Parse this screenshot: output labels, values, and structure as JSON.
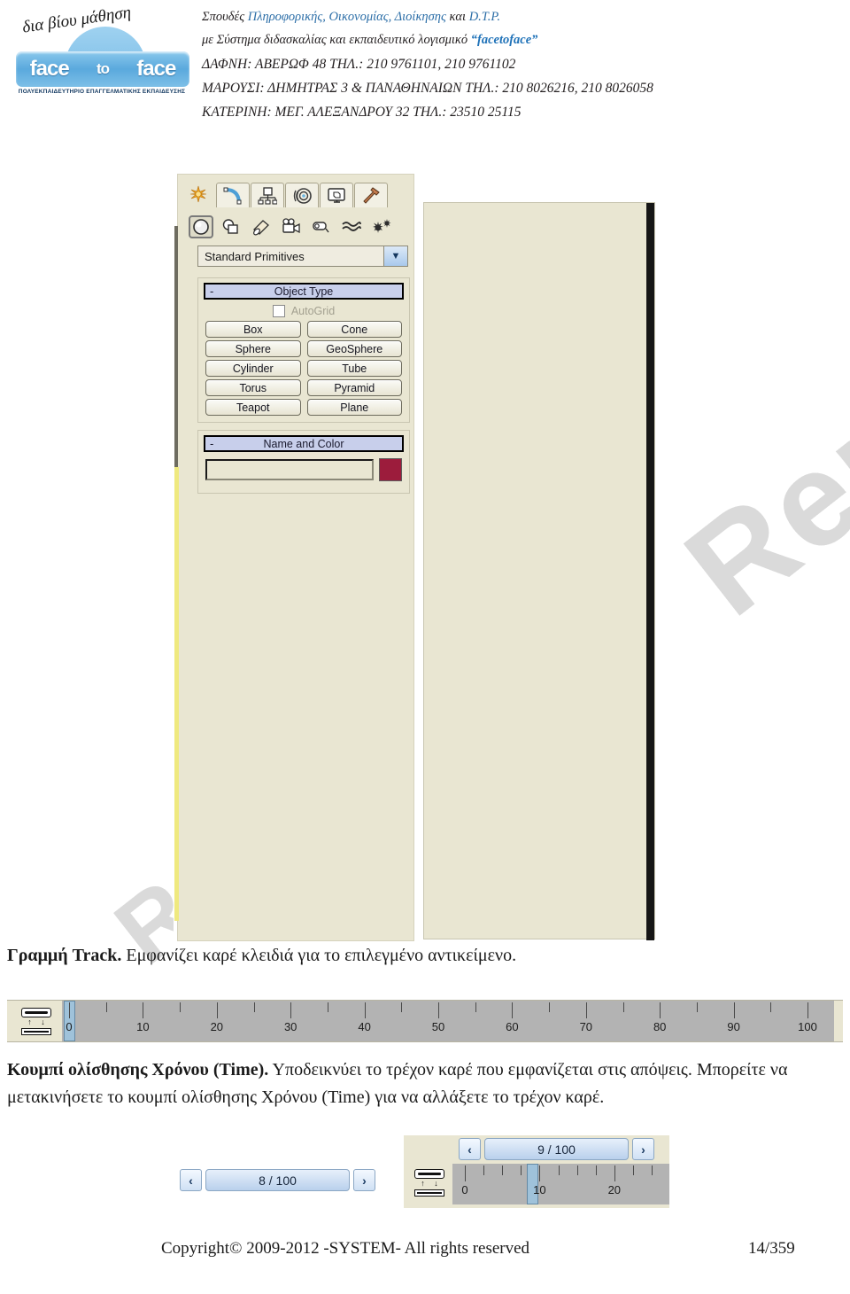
{
  "header": {
    "logo": {
      "script_text": "δια βίου μάθηση",
      "word1": "face",
      "word2": "to",
      "word3": "face",
      "subtitle": "ΠΟΛΥΕΚΠΑΙΔΕΥΤΗΡΙΟ ΕΠΑΓΓΕΛΜΑΤΙΚΗΣ ΕΚΠΑΙΔΕΥΣΗΣ"
    },
    "line1_a": "Σπουδές ",
    "line1_b": "Πληροφορικής, Οικονομίας, Διοίκησης",
    "line1_c": " και ",
    "line1_d": "D.T.P.",
    "line2_a": "με Σύστημα διδασκαλίας και εκπαιδευτικό λογισμικό ",
    "line2_b": "“facetoface”",
    "line3": "ΔΑΦΝΗ: ΑΒΕΡΩΦ 48 ΤΗΛ.: 210 9761101, 210 9761102",
    "line4": "ΜΑΡΟΥΣΙ: ΔΗΜΗΤΡΑΣ 3 & ΠΑΝΑΘΗΝΑΙΩΝ ΤΗΛ.: 210 8026216, 210 8026058",
    "line5": "ΚΑΤΕΡΙΝΗ: ΜΕΓ. ΑΛΕΞΑΝΔΡΟΥ 32 ΤΗΛ.: 23510 25115",
    "accent_color": "#2d6fa8",
    "brand_color": "#1f72b8"
  },
  "command_panel": {
    "tabs": [
      {
        "name": "create-tab",
        "icon": "star-icon",
        "active": true
      },
      {
        "name": "modify-tab",
        "icon": "curve-icon",
        "active": false
      },
      {
        "name": "hierarchy-tab",
        "icon": "hierarchy-icon",
        "active": false
      },
      {
        "name": "motion-tab",
        "icon": "motion-wheel-icon",
        "active": false
      },
      {
        "name": "display-tab",
        "icon": "display-monitor-icon",
        "active": false
      },
      {
        "name": "utilities-tab",
        "icon": "hammer-icon",
        "active": false
      }
    ],
    "category_icons": [
      {
        "name": "geometry-icon",
        "selected": true
      },
      {
        "name": "shapes-icon",
        "selected": false
      },
      {
        "name": "lights-icon",
        "selected": false
      },
      {
        "name": "cameras-icon",
        "selected": false
      },
      {
        "name": "helpers-icon",
        "selected": false
      },
      {
        "name": "space-warps-icon",
        "selected": false
      },
      {
        "name": "systems-icon",
        "selected": false
      }
    ],
    "dropdown": {
      "value": "Standard Primitives",
      "arrow": "▼"
    },
    "object_type": {
      "title": "Object Type",
      "collapse_glyph": "-",
      "autogrid_label": "AutoGrid",
      "autogrid_checked": false,
      "buttons": [
        "Box",
        "Cone",
        "Sphere",
        "GeoSphere",
        "Cylinder",
        "Tube",
        "Torus",
        "Pyramid",
        "Teapot",
        "Plane"
      ]
    },
    "name_and_color": {
      "title": "Name and Color",
      "collapse_glyph": "-",
      "name_value": "",
      "name_placeholder": "",
      "swatch_color": "#9c1c3c"
    },
    "panel_bg_color": "#e9e6d2",
    "highlight_strip_color": "#efe97f"
  },
  "captions": {
    "p1_bold": "Γραμμή Track.",
    "p1_rest": " Εμφανίζει καρέ κλειδιά για το επιλεγμένο αντικείμενο.",
    "p2_bold": "Κουμπί ολίσθησης Χρόνου (Time).",
    "p2_rest": " Υποδεικνύει το τρέχον καρέ που εμφανίζεται στις απόψεις. Μπορείτε να μετακινήσετε  το κουμπί ολίσθησης Χρόνου (Time) για να αλλάξετε το τρέχον καρέ."
  },
  "trackbar": {
    "icon_name": "open-mini-curve-editor-icon",
    "range_start": 0,
    "range_end": 100,
    "major_labels": [
      0,
      10,
      20,
      30,
      40,
      50,
      60,
      70,
      80,
      90,
      100
    ],
    "minor_step": 5,
    "thumb_frame": 0,
    "bg_color": "#b3b3b3",
    "thumb_color": "#9ec4de"
  },
  "time_slider_a": {
    "prev_glyph": "‹",
    "next_glyph": "›",
    "value": "8 / 100"
  },
  "time_slider_b": {
    "prev_glyph": "‹",
    "next_glyph": "›",
    "value": "9 / 100",
    "icon_name": "open-mini-curve-editor-icon",
    "range_start": 0,
    "range_end": 25,
    "major_labels": [
      0,
      10,
      20
    ],
    "minor_step": 2.5,
    "thumb_frame": 9
  },
  "watermark": {
    "text": "Rem",
    "color": "#c8c8c8"
  },
  "footer": {
    "copyright": "Copyright© 2009-2012 -SYSTEM- All rights reserved",
    "page": "14/359"
  }
}
